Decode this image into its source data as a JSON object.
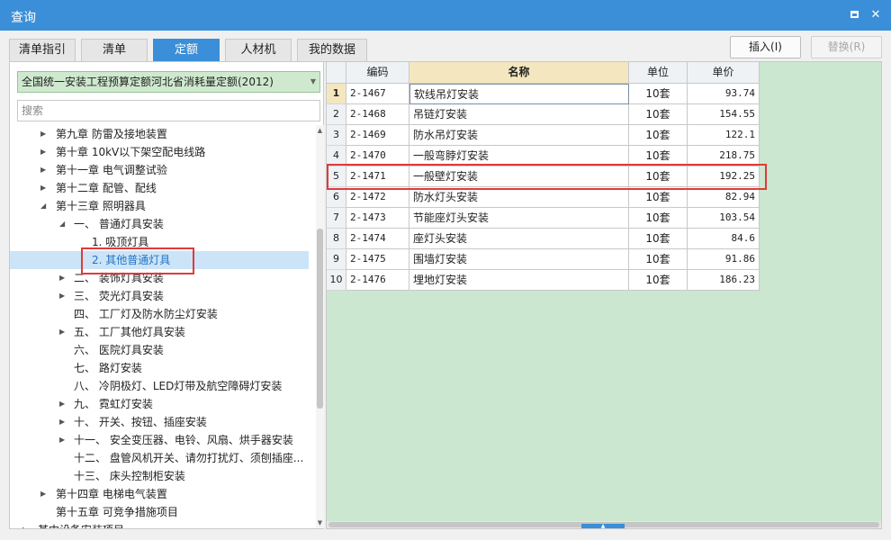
{
  "window": {
    "title": "查询",
    "maximize_icon": "maximize-icon",
    "close_icon": "close-icon",
    "close_glyph": "✕"
  },
  "tabs": [
    {
      "label": "清单指引",
      "active": false
    },
    {
      "label": "清单",
      "active": false
    },
    {
      "label": "定额",
      "active": true
    },
    {
      "label": "人材机",
      "active": false
    },
    {
      "label": "我的数据",
      "active": false
    }
  ],
  "toolbar": {
    "insert_label": "插入(I)",
    "replace_label": "替换(R)"
  },
  "library": {
    "selected": "全国统一安装工程预算定额河北省消耗量定额(2012)"
  },
  "search": {
    "placeholder": "搜索"
  },
  "tree": [
    {
      "level": 0,
      "toggle": "collapsed",
      "label": "第九章 防雷及接地装置"
    },
    {
      "level": 0,
      "toggle": "collapsed",
      "label": "第十章 10kV以下架空配电线路"
    },
    {
      "level": 0,
      "toggle": "collapsed",
      "label": "第十一章 电气调整试验"
    },
    {
      "level": 0,
      "toggle": "collapsed",
      "label": "第十二章 配管、配线"
    },
    {
      "level": 0,
      "toggle": "expanded",
      "label": "第十三章 照明器具"
    },
    {
      "level": 1,
      "toggle": "expanded",
      "label": "一、 普通灯具安装"
    },
    {
      "level": 2,
      "toggle": "none",
      "label": "1. 吸顶灯具"
    },
    {
      "level": 2,
      "toggle": "none",
      "label": "2. 其他普通灯具",
      "selected": true
    },
    {
      "level": 1,
      "toggle": "collapsed",
      "label": "二、 装饰灯具安装"
    },
    {
      "level": 1,
      "toggle": "collapsed",
      "label": "三、 荧光灯具安装"
    },
    {
      "level": 1,
      "toggle": "none",
      "label": "四、 工厂灯及防水防尘灯安装"
    },
    {
      "level": 1,
      "toggle": "collapsed",
      "label": "五、 工厂其他灯具安装"
    },
    {
      "level": 1,
      "toggle": "none",
      "label": "六、 医院灯具安装"
    },
    {
      "level": 1,
      "toggle": "none",
      "label": "七、 路灯安装"
    },
    {
      "level": 1,
      "toggle": "none",
      "label": "八、 冷阴极灯、LED灯带及航空障碍灯安装"
    },
    {
      "level": 1,
      "toggle": "collapsed",
      "label": "九、 霓虹灯安装"
    },
    {
      "level": 1,
      "toggle": "collapsed",
      "label": "十、 开关、按钮、插座安装"
    },
    {
      "level": 1,
      "toggle": "collapsed",
      "label": "十一、 安全变压器、电铃、风扇、烘手器安装"
    },
    {
      "level": 1,
      "toggle": "none",
      "label": "十二、 盘管风机开关、请勿打扰灯、须刨插座..."
    },
    {
      "level": 1,
      "toggle": "none",
      "label": "十三、 床头控制柜安装"
    },
    {
      "level": 0,
      "toggle": "collapsed",
      "label": "第十四章 电梯电气装置"
    },
    {
      "level": 0,
      "toggle": "none",
      "label": "第十五章 可竞争措施项目"
    },
    {
      "level": 0,
      "toggle": "collapsed",
      "label": "其中设备安装项目"
    }
  ],
  "grid": {
    "columns": [
      "编码",
      "名称",
      "单位",
      "单价"
    ],
    "rows": [
      {
        "no": "1",
        "code": "2-1467",
        "name": "软线吊灯安装",
        "unit": "10套",
        "price": "93.74"
      },
      {
        "no": "2",
        "code": "2-1468",
        "name": "吊链灯安装",
        "unit": "10套",
        "price": "154.55"
      },
      {
        "no": "3",
        "code": "2-1469",
        "name": "防水吊灯安装",
        "unit": "10套",
        "price": "122.1"
      },
      {
        "no": "4",
        "code": "2-1470",
        "name": "一般弯脖灯安装",
        "unit": "10套",
        "price": "218.75"
      },
      {
        "no": "5",
        "code": "2-1471",
        "name": "一般壁灯安装",
        "unit": "10套",
        "price": "192.25"
      },
      {
        "no": "6",
        "code": "2-1472",
        "name": "防水灯头安装",
        "unit": "10套",
        "price": "82.94"
      },
      {
        "no": "7",
        "code": "2-1473",
        "name": "节能座灯头安装",
        "unit": "10套",
        "price": "103.54"
      },
      {
        "no": "8",
        "code": "2-1474",
        "name": "座灯头安装",
        "unit": "10套",
        "price": "84.6"
      },
      {
        "no": "9",
        "code": "2-1475",
        "name": "围墙灯安装",
        "unit": "10套",
        "price": "91.86"
      },
      {
        "no": "10",
        "code": "2-1476",
        "name": "埋地灯安装",
        "unit": "10套",
        "price": "186.23"
      }
    ],
    "current_row": 0,
    "highlighted_row": 4
  },
  "colors": {
    "accent": "#3b8fd8",
    "highlight_box": "#e03a3a",
    "grid_background": "#cbe7cf",
    "selected_tree_item": "#cce4f7"
  }
}
